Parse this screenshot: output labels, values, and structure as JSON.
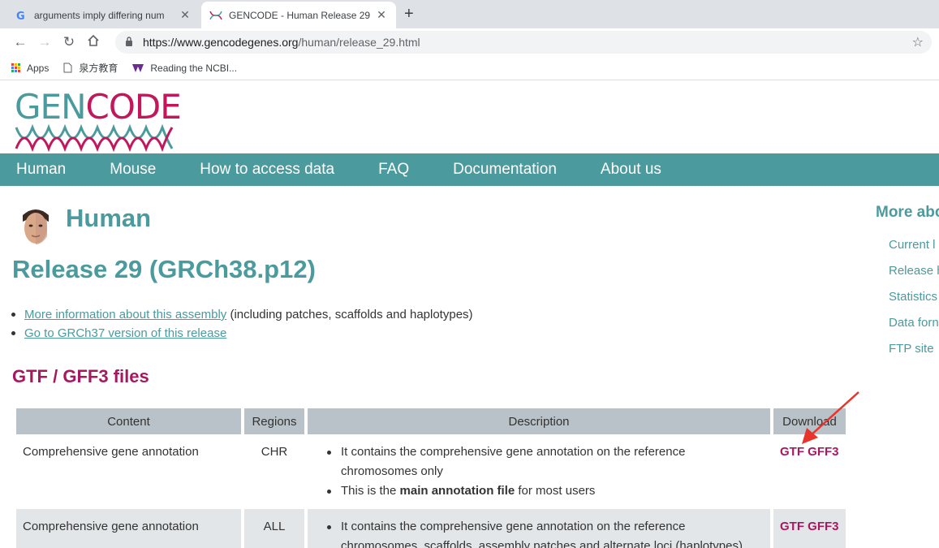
{
  "tabs": [
    {
      "title": "arguments imply differing num",
      "favicon": "google-icon",
      "active": false
    },
    {
      "title": "GENCODE - Human Release 29",
      "favicon": "gencode-icon",
      "active": true
    }
  ],
  "toolbar": {
    "url_host": "https://www.gencodegenes.org",
    "url_path": "/human/release_29.html"
  },
  "bookmarks": [
    {
      "label": "Apps",
      "icon": "apps-grid-icon"
    },
    {
      "label": "泉方教育",
      "icon": "page-icon"
    },
    {
      "label": "Reading the NCBI...",
      "icon": "bookmark-icon"
    }
  ],
  "logo": {
    "gen": "GEN",
    "code": "CODE"
  },
  "nav": [
    "Human",
    "Mouse",
    "How to access data",
    "FAQ",
    "Documentation",
    "About us"
  ],
  "page": {
    "species": "Human",
    "release": "Release 29 (GRCh38.p12)",
    "links": [
      {
        "link": "More information about this assembly",
        "suffix": " (including patches, scaffolds and haplotypes)"
      },
      {
        "link": "Go to GRCh37 version of this release",
        "suffix": ""
      }
    ],
    "section": "GTF / GFF3 files"
  },
  "table": {
    "headers": [
      "Content",
      "Regions",
      "Description",
      "Download"
    ],
    "rows": [
      {
        "content": "Comprehensive gene annotation",
        "regions": "CHR",
        "desc1": "It contains the comprehensive gene annotation on the reference chromosomes only",
        "desc2_pre": "This is the ",
        "desc2_bold": "main annotation file",
        "desc2_post": " for most users",
        "download": "GTF GFF3"
      },
      {
        "content": "Comprehensive gene annotation",
        "regions": "ALL",
        "desc1": "It contains the comprehensive gene annotation on the reference chromosomes, scaffolds, assembly patches and alternate loci (haplotypes)",
        "download": "GTF GFF3"
      }
    ]
  },
  "sidebar": {
    "title": "More abo",
    "items": [
      "Current l",
      "Release h",
      "Statistics",
      "Data forn",
      "FTP site"
    ]
  },
  "colors": {
    "teal": "#4b9a9e",
    "magenta": "#a6195e",
    "arrow": "#e8342a"
  }
}
